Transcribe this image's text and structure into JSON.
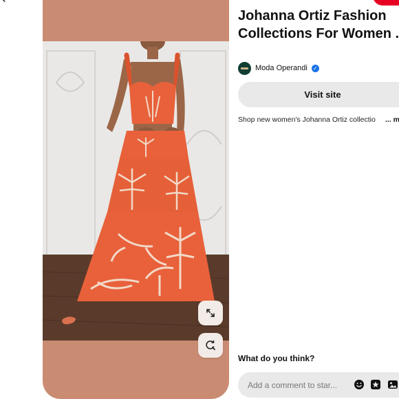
{
  "nav": {
    "back_icon": "arrow-left-icon"
  },
  "pin": {
    "title_line1": "Johanna Ortiz Fashion",
    "title_line2": "Collections For Women ...",
    "image_alt": "Model wearing orange tiered maxi skirt and bustier top with palm print",
    "colors": {
      "card_background": "#c98c72",
      "dress": "#e8613b"
    }
  },
  "author": {
    "name": "Moda Operandi",
    "verified": true
  },
  "actions": {
    "visit_label": "Visit site"
  },
  "description": {
    "text": "Shop new women's Johanna Ortiz collectio",
    "more_label": "... m"
  },
  "comments": {
    "heading": "What do you think?",
    "placeholder": "Add a comment to star..."
  },
  "icons": {
    "expand": "expand-icon",
    "visual_search": "visual-search-icon",
    "emoji": "emoji-icon",
    "sticker": "sticker-icon",
    "photo": "photo-icon"
  }
}
